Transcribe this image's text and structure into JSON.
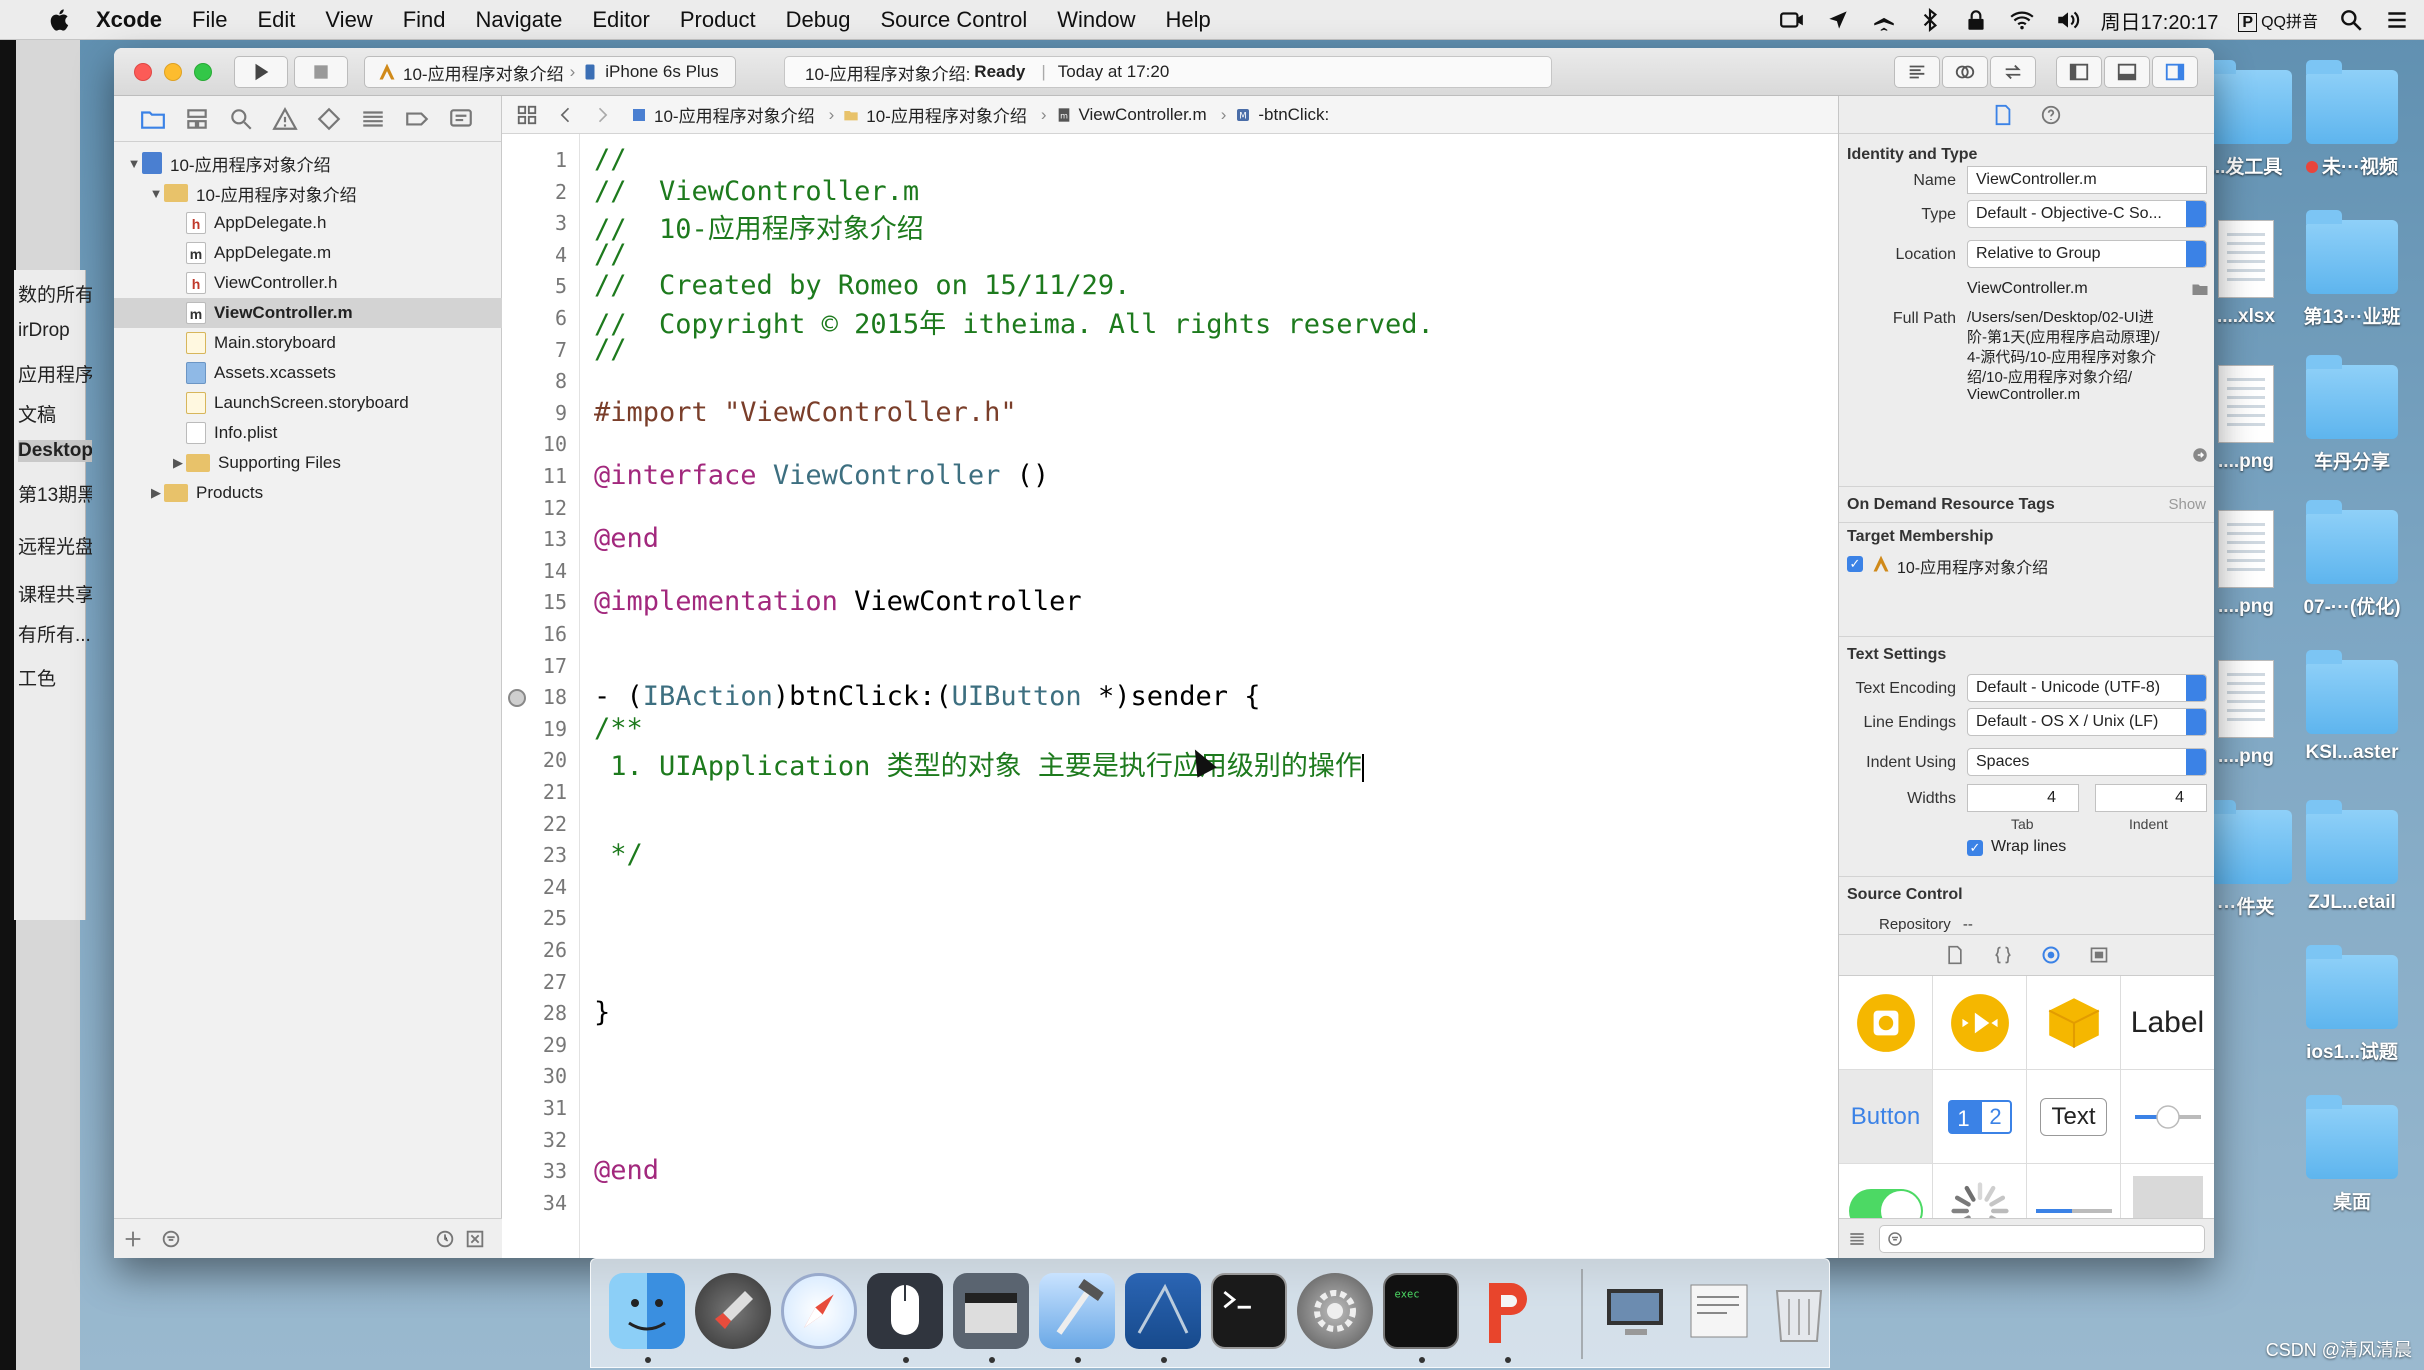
{
  "menubar": {
    "app_name": "Xcode",
    "items": [
      "File",
      "Edit",
      "View",
      "Find",
      "Navigate",
      "Editor",
      "Product",
      "Debug",
      "Source Control",
      "Window",
      "Help"
    ],
    "clock": "周日17:20:17",
    "input_method": "QQ拼音"
  },
  "toolbar": {
    "scheme": "10-应用程序对象介绍",
    "device": "iPhone 6s Plus",
    "status_project": "10-应用程序对象介绍:",
    "status_state": "Ready",
    "status_time": "Today at 17:20"
  },
  "navigator": {
    "items": [
      {
        "label": "10-应用程序对象介绍",
        "kind": "proj",
        "level": 0,
        "expanded": true
      },
      {
        "label": "10-应用程序对象介绍",
        "kind": "folder",
        "level": 1,
        "expanded": true
      },
      {
        "label": "AppDelegate.h",
        "kind": "h",
        "level": 2
      },
      {
        "label": "AppDelegate.m",
        "kind": "m",
        "level": 2
      },
      {
        "label": "ViewController.h",
        "kind": "h",
        "level": 2
      },
      {
        "label": "ViewController.m",
        "kind": "m",
        "level": 2,
        "selected": true
      },
      {
        "label": "Main.storyboard",
        "kind": "sb",
        "level": 2
      },
      {
        "label": "Assets.xcassets",
        "kind": "xa",
        "level": 2
      },
      {
        "label": "LaunchScreen.storyboard",
        "kind": "sb",
        "level": 2
      },
      {
        "label": "Info.plist",
        "kind": "pl",
        "level": 2
      },
      {
        "label": "Supporting Files",
        "kind": "folder",
        "level": 2,
        "collapsed": true
      },
      {
        "label": "Products",
        "kind": "folder",
        "level": 1,
        "collapsed": true
      }
    ]
  },
  "jumpbar": {
    "project": "10-应用程序对象介绍",
    "group": "10-应用程序对象介绍",
    "file": "ViewController.m",
    "method": "-btnClick:"
  },
  "code_lines": [
    [
      {
        "c": "cm",
        "t": "//"
      }
    ],
    [
      {
        "c": "cm",
        "t": "//  ViewController.m"
      }
    ],
    [
      {
        "c": "cm",
        "t": "//  10-应用程序对象介绍"
      }
    ],
    [
      {
        "c": "cm",
        "t": "//"
      }
    ],
    [
      {
        "c": "cm",
        "t": "//  Created by Romeo on 15/11/29."
      }
    ],
    [
      {
        "c": "cm",
        "t": "//  Copyright © 2015年 itheima. All rights reserved."
      }
    ],
    [
      {
        "c": "cm",
        "t": "//"
      }
    ],
    [],
    [
      {
        "c": "pp",
        "t": "#import \"ViewController.h\""
      }
    ],
    [],
    [
      {
        "c": "kw",
        "t": "@interface"
      },
      {
        "c": "pl",
        "t": " "
      },
      {
        "c": "ty",
        "t": "ViewController"
      },
      {
        "c": "pl",
        "t": " ()"
      }
    ],
    [],
    [
      {
        "c": "kw",
        "t": "@end"
      }
    ],
    [],
    [
      {
        "c": "kw",
        "t": "@implementation"
      },
      {
        "c": "pl",
        "t": " ViewController"
      }
    ],
    [],
    [],
    [
      {
        "c": "pl",
        "t": "- ("
      },
      {
        "c": "ty",
        "t": "IBAction"
      },
      {
        "c": "pl",
        "t": ")btnClick:("
      },
      {
        "c": "ty",
        "t": "UIButton"
      },
      {
        "c": "pl",
        "t": " *)sender {"
      }
    ],
    [
      {
        "c": "cm",
        "t": "/**"
      }
    ],
    [
      {
        "c": "cm",
        "t": " 1. UIApplication 类型的对象 主要是执行应用级别的操作"
      }
    ],
    [],
    [],
    [
      {
        "c": "cm",
        "t": " */"
      }
    ],
    [],
    [],
    [],
    [],
    [
      {
        "c": "pl",
        "t": "}"
      }
    ],
    [],
    [],
    [],
    [],
    [
      {
        "c": "kw",
        "t": "@end"
      }
    ],
    []
  ],
  "inspector": {
    "identity_title": "Identity and Type",
    "name_label": "Name",
    "name_value": "ViewController.m",
    "type_label": "Type",
    "type_value": "Default - Objective-C So...",
    "location_label": "Location",
    "location_value": "Relative to Group",
    "location_file": "ViewController.m",
    "fullpath_label": "Full Path",
    "fullpath_lines": [
      "/Users/sen/Desktop/02-UI进",
      "阶-第1天(应用程序启动原理)/",
      "4-源代码/10-应用程序对象介",
      "绍/10-应用程序对象介绍/",
      "ViewController.m"
    ],
    "odr_title": "On Demand Resource Tags",
    "odr_show": "Show",
    "target_title": "Target Membership",
    "target_value": "10-应用程序对象介绍",
    "text_settings_title": "Text Settings",
    "encoding_label": "Text Encoding",
    "encoding_value": "Default - Unicode (UTF-8)",
    "endings_label": "Line Endings",
    "endings_value": "Default - OS X / Unix (LF)",
    "indent_label": "Indent Using",
    "indent_value": "Spaces",
    "widths_label": "Widths",
    "tab_value": "4",
    "indent_width_value": "4",
    "tab_caption": "Tab",
    "indent_caption": "Indent",
    "wrap_label": "Wrap lines",
    "source_control_title": "Source Control",
    "repository_label": "Repository",
    "repository_value": "--"
  },
  "library": {
    "label_text": "Label",
    "button_text": "Button",
    "seg1": "1",
    "seg2": "2",
    "textfield_text": "Text"
  },
  "desktop": {
    "left_labels": [
      "数的所有",
      "irDrop",
      "应用程序",
      "文稿",
      "Desktop",
      "第13期黑",
      "远程光盘",
      "课程共享",
      "有所有...",
      "工色"
    ],
    "icons": [
      {
        "label": "...发工具"
      },
      {
        "label": "未···视频"
      },
      {
        "label": "....xlsx"
      },
      {
        "label": "第13···业班"
      },
      {
        "label": "....png"
      },
      {
        "label": "车丹分享"
      },
      {
        "label": "....png"
      },
      {
        "label": "07-···(优化)"
      },
      {
        "label": "....png"
      },
      {
        "label": "KSI...aster"
      },
      {
        "label": "···件夹"
      },
      {
        "label": "ZJL...etail"
      },
      {
        "label": "ios1...试题"
      },
      {
        "label": "桌面"
      }
    ]
  },
  "watermark": "CSDN @清风清晨",
  "colors": {
    "accent": "#3b82e6",
    "comment": "#1d7a1d",
    "keyword": "#a2287d",
    "type": "#3d6f80",
    "preprocessor": "#7a3e2a"
  }
}
